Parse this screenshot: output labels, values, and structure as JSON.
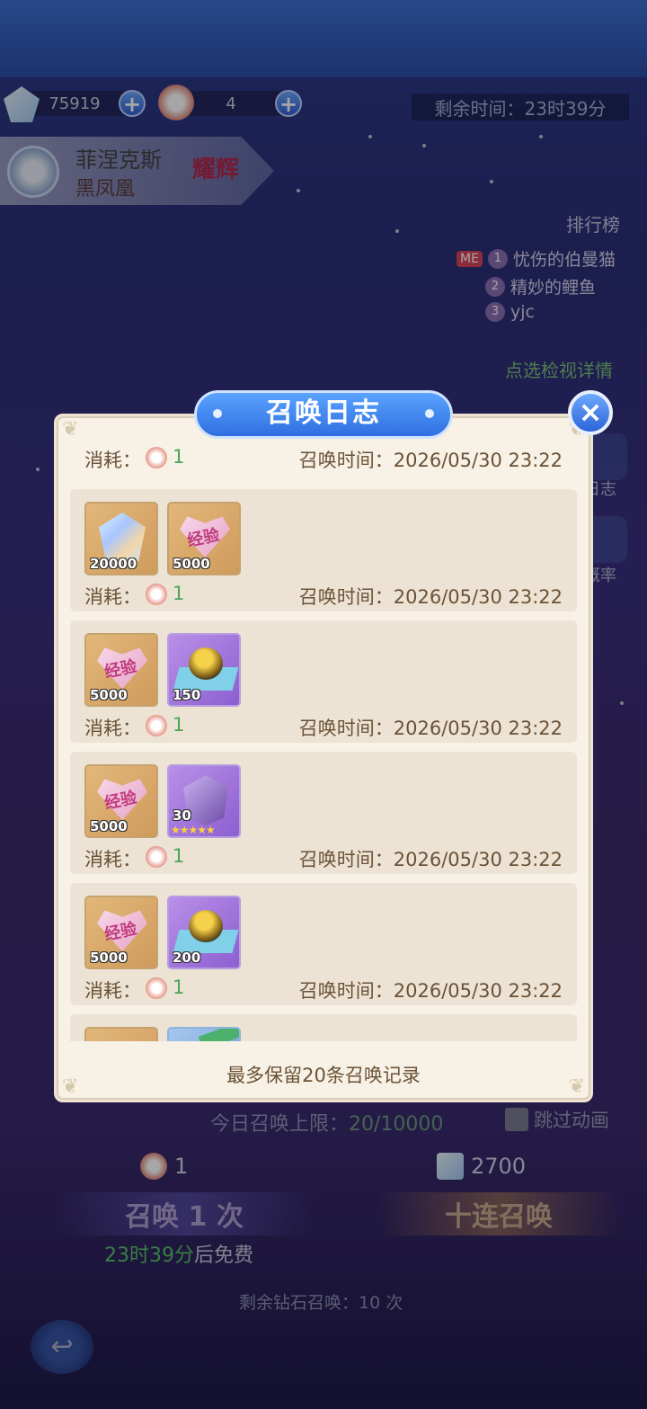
{
  "resources": {
    "diamonds": "75919",
    "tickets": "4"
  },
  "timer": "剩余时间：23时39分",
  "hero": {
    "name": "菲涅克斯",
    "subtitle": "黑凤凰",
    "tag": "耀辉"
  },
  "ranking": {
    "title": "排行榜",
    "me_badge": "ME",
    "entries": [
      {
        "rank": "1",
        "name": "忧伤的伯曼猫"
      },
      {
        "rank": "2",
        "name": "精妙的鲤鱼"
      },
      {
        "rank": "3",
        "name": "yjc"
      }
    ],
    "detail_link": "点选检视详情"
  },
  "side": {
    "log_label": "日志",
    "rate_label": "概率"
  },
  "modal": {
    "title": "召唤日志",
    "close": "×",
    "first_entry": {
      "cost_label": "消耗：",
      "cost": "1",
      "time": "召唤时间：2026/05/30 23:22"
    },
    "entries": [
      {
        "items": [
          {
            "kind": "diamond",
            "qty": "20000"
          },
          {
            "kind": "exp",
            "qty": "5000",
            "label": "经验"
          }
        ],
        "cost_label": "消耗：",
        "cost": "1",
        "time": "召唤时间：2026/05/30 23:22"
      },
      {
        "items": [
          {
            "kind": "exp",
            "qty": "5000",
            "label": "经验"
          },
          {
            "kind": "egg",
            "qty": "150"
          }
        ],
        "cost_label": "消耗：",
        "cost": "1",
        "time": "召唤时间：2026/05/30 23:22"
      },
      {
        "items": [
          {
            "kind": "exp",
            "qty": "5000",
            "label": "经验"
          },
          {
            "kind": "gem",
            "qty": "30"
          }
        ],
        "cost_label": "消耗：",
        "cost": "1",
        "time": "召唤时间：2026/05/30 23:22"
      },
      {
        "items": [
          {
            "kind": "exp",
            "qty": "5000",
            "label": "经验"
          },
          {
            "kind": "egg",
            "qty": "200"
          }
        ],
        "cost_label": "消耗：",
        "cost": "1",
        "time": "召唤时间：2026/05/30 23:22"
      }
    ],
    "footer": "最多保留20条召唤记录"
  },
  "summon": {
    "limit_label": "今日召唤上限：",
    "limit_value": "20/10000",
    "skip_label": "跳过动画",
    "single_cost": "1",
    "ten_cost": "2700",
    "single_button": "召唤 1 次",
    "ten_button": "十连召唤",
    "free_time": "23时39分",
    "free_suffix": "后免费",
    "remaining_diamond": "剩余钻石召唤：10 次"
  },
  "colors": {
    "modal_bg": "#f7f1e6",
    "card_bg": "#ece3d5",
    "title_blue": "#2e6fe0",
    "text_brown": "#6b5236",
    "cost_green": "#4aa55a"
  }
}
